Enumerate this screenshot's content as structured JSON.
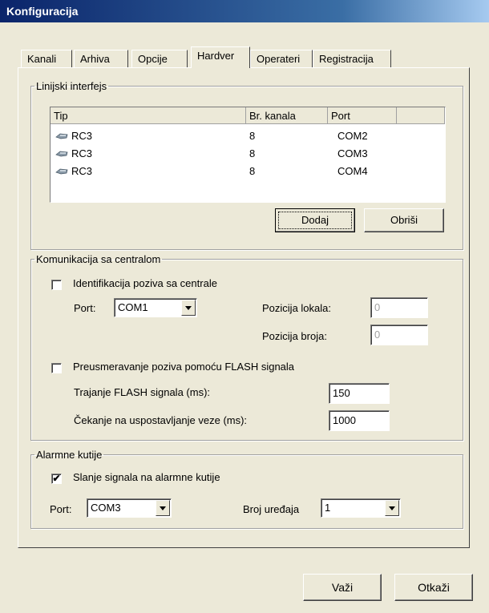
{
  "window": {
    "title": "Konfiguracija"
  },
  "tabs": [
    {
      "label": "Kanali"
    },
    {
      "label": "Arhiva"
    },
    {
      "label": "Opcije"
    },
    {
      "label": "Hardver"
    },
    {
      "label": "Operateri"
    },
    {
      "label": "Registracija"
    }
  ],
  "active_tab": "Hardver",
  "line_interface": {
    "legend": "Linijski interfejs",
    "columns": [
      "Tip",
      "Br. kanala",
      "Port"
    ],
    "rows": [
      {
        "tip": "RC3",
        "kanala": "8",
        "port": "COM2",
        "icon": "device-icon"
      },
      {
        "tip": "RC3",
        "kanala": "8",
        "port": "COM3",
        "icon": "device-icon"
      },
      {
        "tip": "RC3",
        "kanala": "8",
        "port": "COM4",
        "icon": "device-icon"
      }
    ],
    "add_label": "Dodaj",
    "delete_label": "Obriši"
  },
  "central": {
    "legend": "Komunikacija sa centralom",
    "caller_id_label": "Identifikacija poziva sa centrale",
    "caller_id_checked": false,
    "port_label": "Port:",
    "port_value": "COM1",
    "local_pos_label": "Pozicija lokala:",
    "local_pos_value": "0",
    "number_pos_label": "Pozicija broja:",
    "number_pos_value": "0",
    "flash_label": "Preusmeravanje poziva pomoću FLASH signala",
    "flash_checked": false,
    "flash_duration_label": "Trajanje FLASH signala (ms):",
    "flash_duration_value": "150",
    "wait_label": "Čekanje na uspostavljanje veze (ms):",
    "wait_value": "1000"
  },
  "alarm": {
    "legend": "Alarmne kutije",
    "send_label": "Slanje signala na alarmne kutije",
    "send_checked": true,
    "port_label": "Port:",
    "port_value": "COM3",
    "devices_label": "Broj uređaja",
    "devices_value": "1"
  },
  "footer": {
    "ok_label": "Važi",
    "cancel_label": "Otkaži"
  },
  "colors": {
    "face": "#ece9d8",
    "title_start": "#0a246a",
    "title_end": "#a6caf0"
  }
}
